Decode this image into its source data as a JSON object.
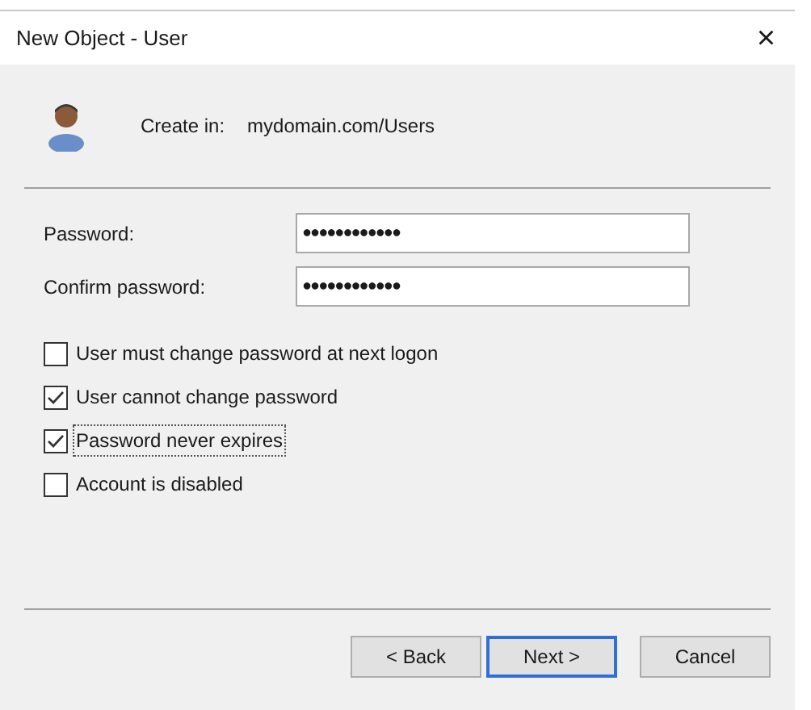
{
  "window": {
    "title": "New Object - User",
    "close": "×"
  },
  "header": {
    "label": "Create in:",
    "value": "mydomain.com/Users"
  },
  "fields": [
    {
      "label": "Password:",
      "value": "●●●●●●●●●●●●"
    },
    {
      "label": "Confirm password:",
      "value": "●●●●●●●●●●●●"
    }
  ],
  "options": [
    {
      "label": "User must change password at next logon",
      "checked": false,
      "focused": false
    },
    {
      "label": "User cannot change password",
      "checked": true,
      "focused": false
    },
    {
      "label": "Password never expires",
      "checked": true,
      "focused": true
    },
    {
      "label": "Account is disabled",
      "checked": false,
      "focused": false
    }
  ],
  "buttons": [
    {
      "label": "< Back",
      "default": false
    },
    {
      "label": "Next >",
      "default": true
    },
    {
      "label": "Cancel",
      "default": false
    }
  ]
}
